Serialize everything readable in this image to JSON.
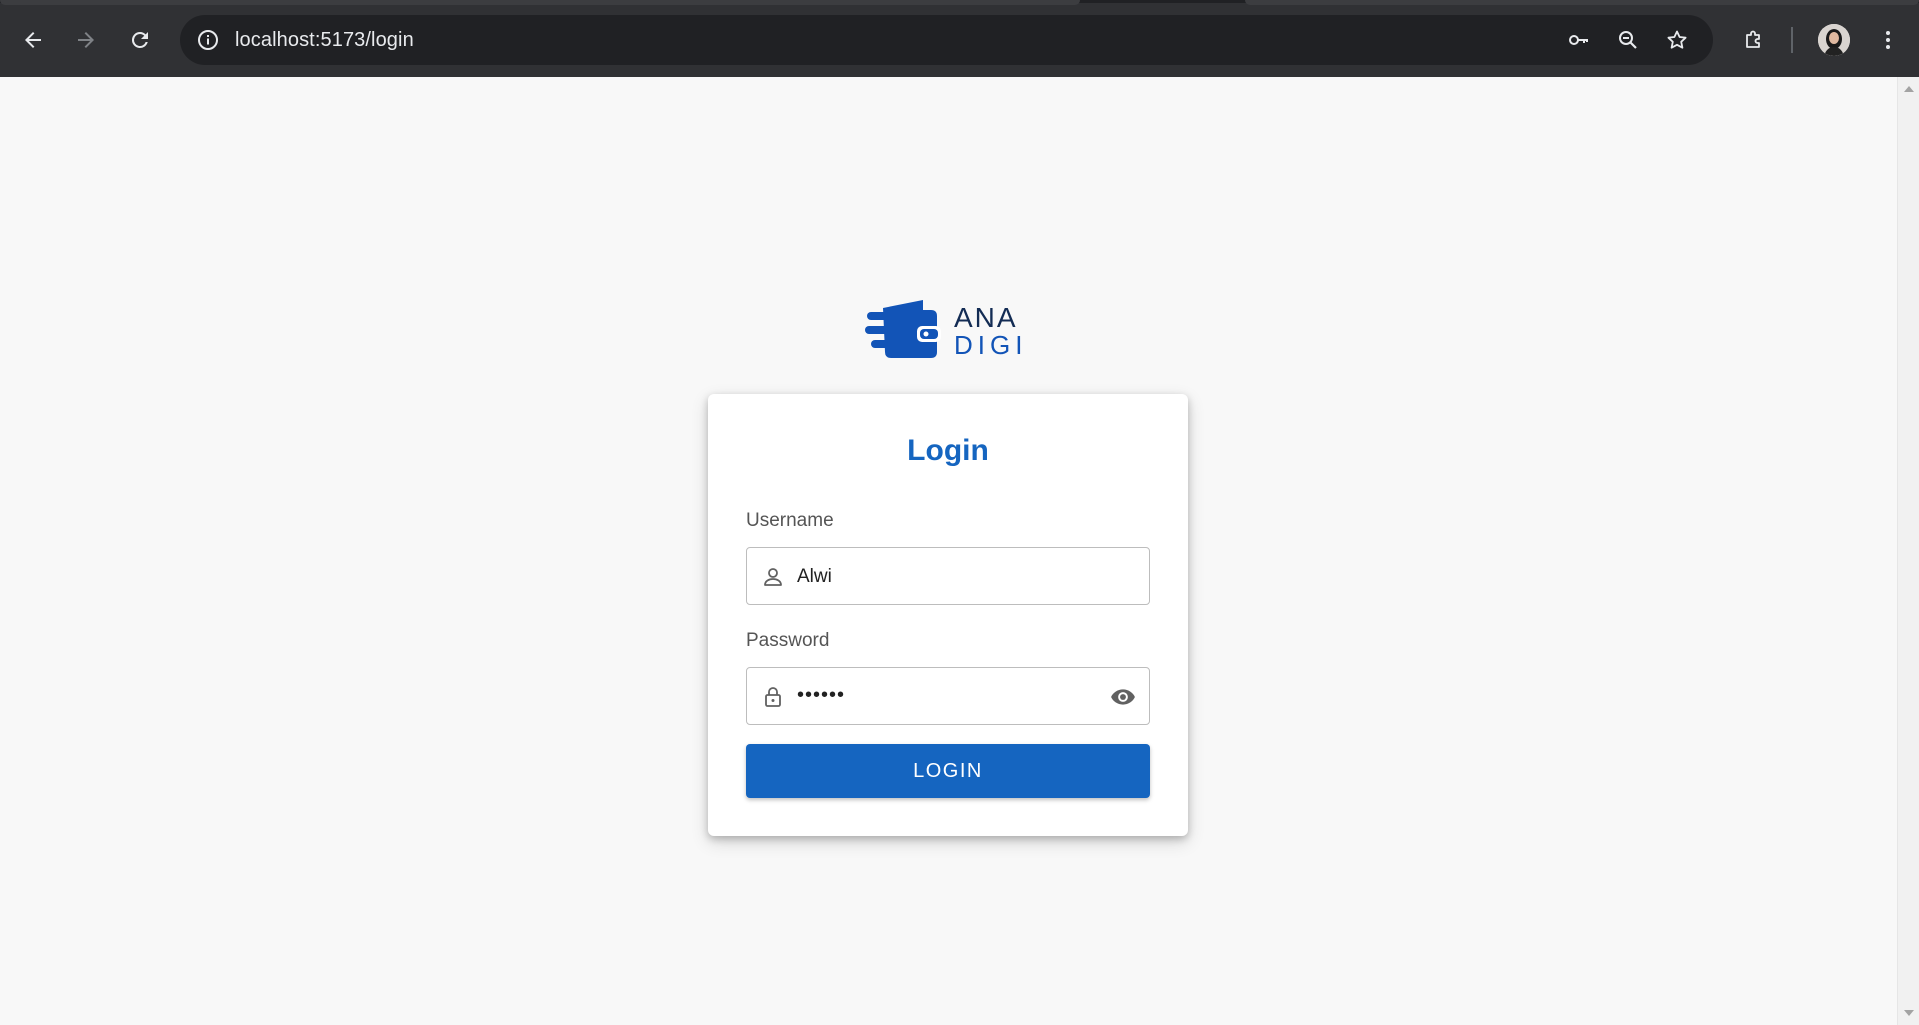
{
  "browser": {
    "url": "localhost:5173/login",
    "icons": {
      "back": "arrow-left-icon",
      "forward": "arrow-right-icon",
      "reload": "reload-icon",
      "site_info": "info-icon",
      "passwords": "key-icon",
      "zoom": "zoom-out-icon",
      "bookmark": "star-icon",
      "extensions": "puzzle-icon",
      "menu": "kebab-menu-icon"
    }
  },
  "brand": {
    "line1": "ANA",
    "line2": "DIGI",
    "colors": {
      "dark": "#132c54",
      "primary": "#1254b7"
    }
  },
  "login": {
    "title": "Login",
    "username": {
      "label": "Username",
      "value": "Alwi"
    },
    "password": {
      "label": "Password",
      "value": "••••••"
    },
    "button_label": "LOGIN"
  },
  "theme": {
    "accent": "#1565c0",
    "background": "#f8f8f8"
  }
}
